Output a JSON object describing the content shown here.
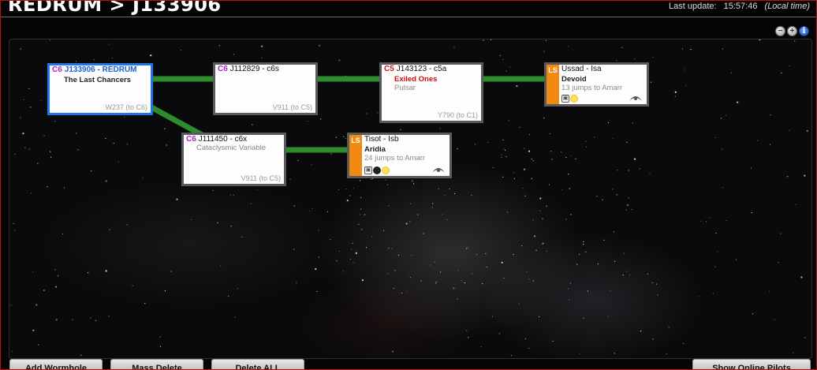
{
  "header": {
    "title": "REDRUM > J133906",
    "last_update_label": "Last update:",
    "last_update_time": "15:57:46",
    "local_time_label": "(Local time)"
  },
  "zoom": {
    "zoom_out_icon": "zoom-out-icon",
    "zoom_in_icon": "zoom-in-icon",
    "info_icon": "info-icon"
  },
  "nodes": {
    "j133906": {
      "class": "C6",
      "name": "J133906 - REDRUM",
      "line1": "The Last Chancers",
      "sig": "W237 (to C6)"
    },
    "j112829": {
      "class": "C6",
      "name": "J112829 - c6s",
      "sig": "V911 (to C5)"
    },
    "j143123": {
      "class": "C5",
      "name": "J143123 - c5a",
      "line1": "Exiled Ones",
      "line2": "Pulsar",
      "sig": "Y790 (to C1)"
    },
    "ussad": {
      "class": "LS",
      "name": "Ussad - Isa",
      "line1": "Devoid",
      "line2": "13 jumps to Amarr"
    },
    "j111450": {
      "class": "C6",
      "name": "J111450 - c6x",
      "line1": "Cataclysmic Variable",
      "sig": "V911 (to C5)"
    },
    "tisot": {
      "class": "LS",
      "name": "Tisot - Isb",
      "line1": "Aridia",
      "line2": "24 jumps to Amarr"
    }
  },
  "connection_color": "#2e8b2e",
  "buttons": {
    "add_wormhole": "Add Wormhole",
    "mass_delete": "Mass Delete",
    "delete_all": "Delete ALL",
    "show_online_pilots": "Show Online Pilots"
  },
  "colors": {
    "frame_border": "#b01515",
    "current_node_border": "#1f74e8",
    "lowsec_tag": "#f28a12",
    "c6_class": "#b022c8",
    "c5_class": "#d01818"
  }
}
